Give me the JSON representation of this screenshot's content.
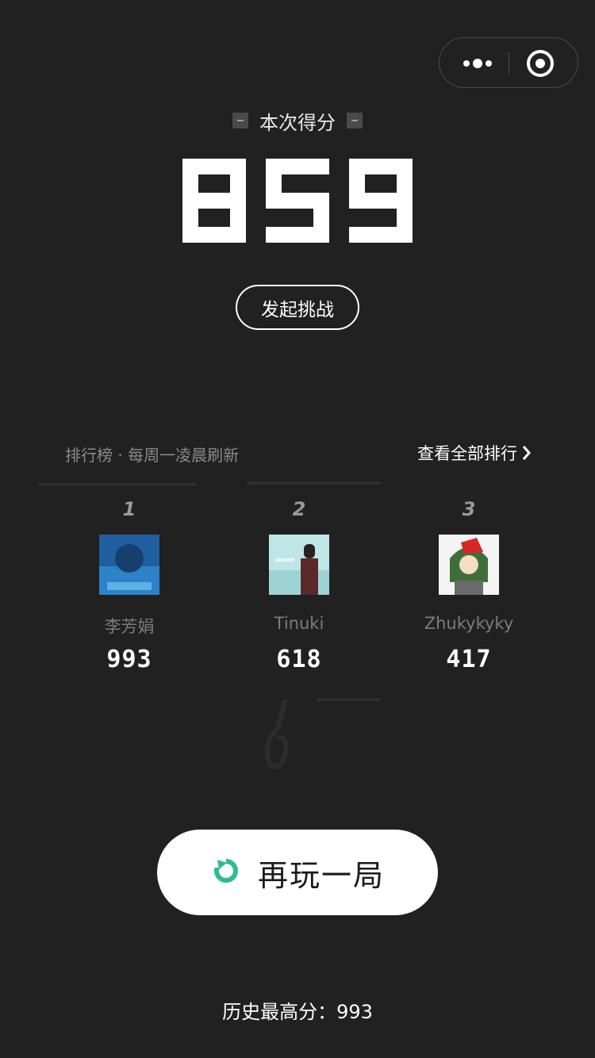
{
  "header": {
    "score_label": "本次得分",
    "score": "859",
    "challenge_button": "发起挑战"
  },
  "capsule": {
    "more_icon": "more-dots-icon",
    "close_icon": "target-close-icon"
  },
  "leaderboard": {
    "title": "排行榜 · 每周一凌晨刷新",
    "view_all": "查看全部排行",
    "players": [
      {
        "rank": "1",
        "name": "李芳娟",
        "score": "993"
      },
      {
        "rank": "2",
        "name": "Tinuki",
        "score": "618"
      },
      {
        "rank": "3",
        "name": "Zhukykyky",
        "score": "417"
      }
    ]
  },
  "replay": {
    "label": "再玩一局",
    "icon": "refresh-icon",
    "accent": "#2bbd8a"
  },
  "footer": {
    "history_best": "历史最高分：993"
  }
}
